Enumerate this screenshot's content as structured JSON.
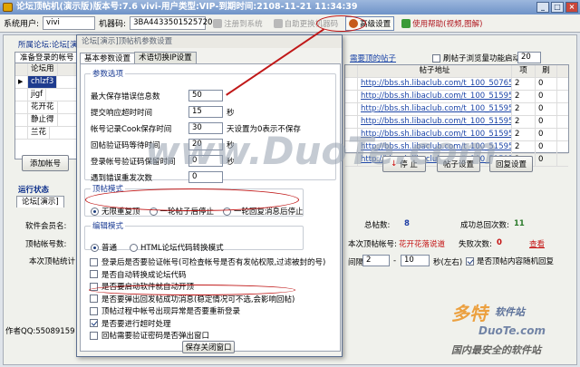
{
  "titlebar": {
    "title": "论坛顶帖机(演示版)版本号:7.6  vivi-用户类型:VIP-到期时间:2108-11-21 11:34:39"
  },
  "toolbar": {
    "user_label": "系统用户:",
    "user_value": "vivi",
    "machine_label": "机器码:",
    "machine_value": "3BA4433501525720",
    "btn_register": "注册到系统",
    "btn_auth": "自助更换机器码",
    "btn_advanced": "高级设置",
    "btn_help": "使用帮助(视频,图解)"
  },
  "left_group": {
    "title": "所属论坛:论坛[演示]顶帖机参数设置",
    "tabs": [
      "准备登录的帐号"
    ],
    "header": "论坛用",
    "rows": [
      "chlzf3",
      "jigf",
      "花开花",
      "静止得",
      "兰花"
    ],
    "btn_add_account": "添加帐号"
  },
  "right_group": {
    "title": "需要顶的帖子",
    "checkbox_label": "刷帖子浏览量功能启动",
    "checkbox_value": "20",
    "headers": [
      "帖子地址",
      "项",
      "刷"
    ],
    "rows": [
      {
        "url": "http://bbs.sh.libaclub.com/t_100_50765...",
        "a": "2",
        "b": "0"
      },
      {
        "url": "http://bbs.sh.libaclub.com/t_100_51595...",
        "a": "2",
        "b": "0"
      },
      {
        "url": "http://bbs.sh.libaclub.com/t_100_51595...",
        "a": "2",
        "b": "0"
      },
      {
        "url": "http://bbs.sh.libaclub.com/t_100_51595...",
        "a": "2",
        "b": "0"
      },
      {
        "url": "http://bbs.sh.libaclub.com/t_100_51595...",
        "a": "2",
        "b": "0"
      },
      {
        "url": "http://bbs.sh.libaclub.com/t_100_51595...",
        "a": "2",
        "b": "0"
      },
      {
        "url": "http://bbs.sh.libaclub.com/t_100_51595...",
        "a": "2",
        "b": "0"
      }
    ],
    "btn_stop": "停 止",
    "btn_post_settings": "帖子设置",
    "btn_reply_settings": "回复设置"
  },
  "status": {
    "title": "运行状态",
    "tab": "论坛[演示]",
    "member_label": "软件会员名:",
    "account_label": "顶帖帐号数:",
    "current_label": "本次顶帖统计",
    "total_posts_label": "总帖数:",
    "total_posts_value": "8",
    "success_label": "成功总回次数:",
    "success_value": "11",
    "current_account_label": "本次顶帖帐号:",
    "current_account_value": "花开花落说道",
    "fail_label": "失败次数:",
    "fail_value": "0",
    "view_link": "查看",
    "interval_label": "间隔:",
    "interval_from": "2",
    "interval_to": "10",
    "interval_unit": "秒(左右)",
    "auto_reply_label": "是否顶帖内容随机回复",
    "author_prefix": "作者QQ:55089159  更新"
  },
  "dialog": {
    "title": "论坛[演示]顶帖机参数设置",
    "tabs": [
      "基本参数设置",
      "术语切换IP设置"
    ],
    "section_basic": "参数选项",
    "fields": [
      {
        "label": "最大保存错误信息数",
        "value": "50",
        "unit": ""
      },
      {
        "label": "提交响应超时时间",
        "value": "15",
        "unit": "秒"
      },
      {
        "label": "帐号记录Cook保存时间",
        "value": "30",
        "unit": "天设置为0表示不保存"
      },
      {
        "label": "回帖验证码等待时间",
        "value": "20",
        "unit": "秒"
      },
      {
        "label": "登录帐号验证码保留时间",
        "value": "0",
        "unit": "秒"
      },
      {
        "label": "遇到错误重发次数",
        "value": "0",
        "unit": ""
      }
    ],
    "section_mode": "顶帖模式",
    "modes": [
      "无限重复顶",
      "一轮帖子后停止",
      "一轮回复消息后停止"
    ],
    "section_edit": "编辑模式",
    "edits": [
      "普通",
      "HTML论坛代码转换模式"
    ],
    "options": [
      {
        "label": "登录后是否要验证帐号(可检查帐号是否有发帖权限,过滤被封的号)",
        "checked": false
      },
      {
        "label": "是否自动转换成论坛代码",
        "checked": false
      },
      {
        "label": "是否要启动软件就自动开顶",
        "checked": false
      },
      {
        "label": "是否要弹出回发帖成功消息(稳定情况可不选,会影响回帖)",
        "checked": false
      },
      {
        "label": "顶帖过程中帐号出现异常是否要重新登录",
        "checked": false
      },
      {
        "label": "是否要进行超时处理",
        "checked": true
      },
      {
        "label": "回帖需要验证密码是否弹出窗口",
        "checked": false
      }
    ],
    "btn_save": "保存关闭窗口"
  },
  "watermarks": {
    "duote": "www.DuoTe.com",
    "brand": "多特",
    "brand_sub": "软件站",
    "brand_url": "DuoTe.com",
    "brand_slogan": "国内最安全的软件站"
  }
}
